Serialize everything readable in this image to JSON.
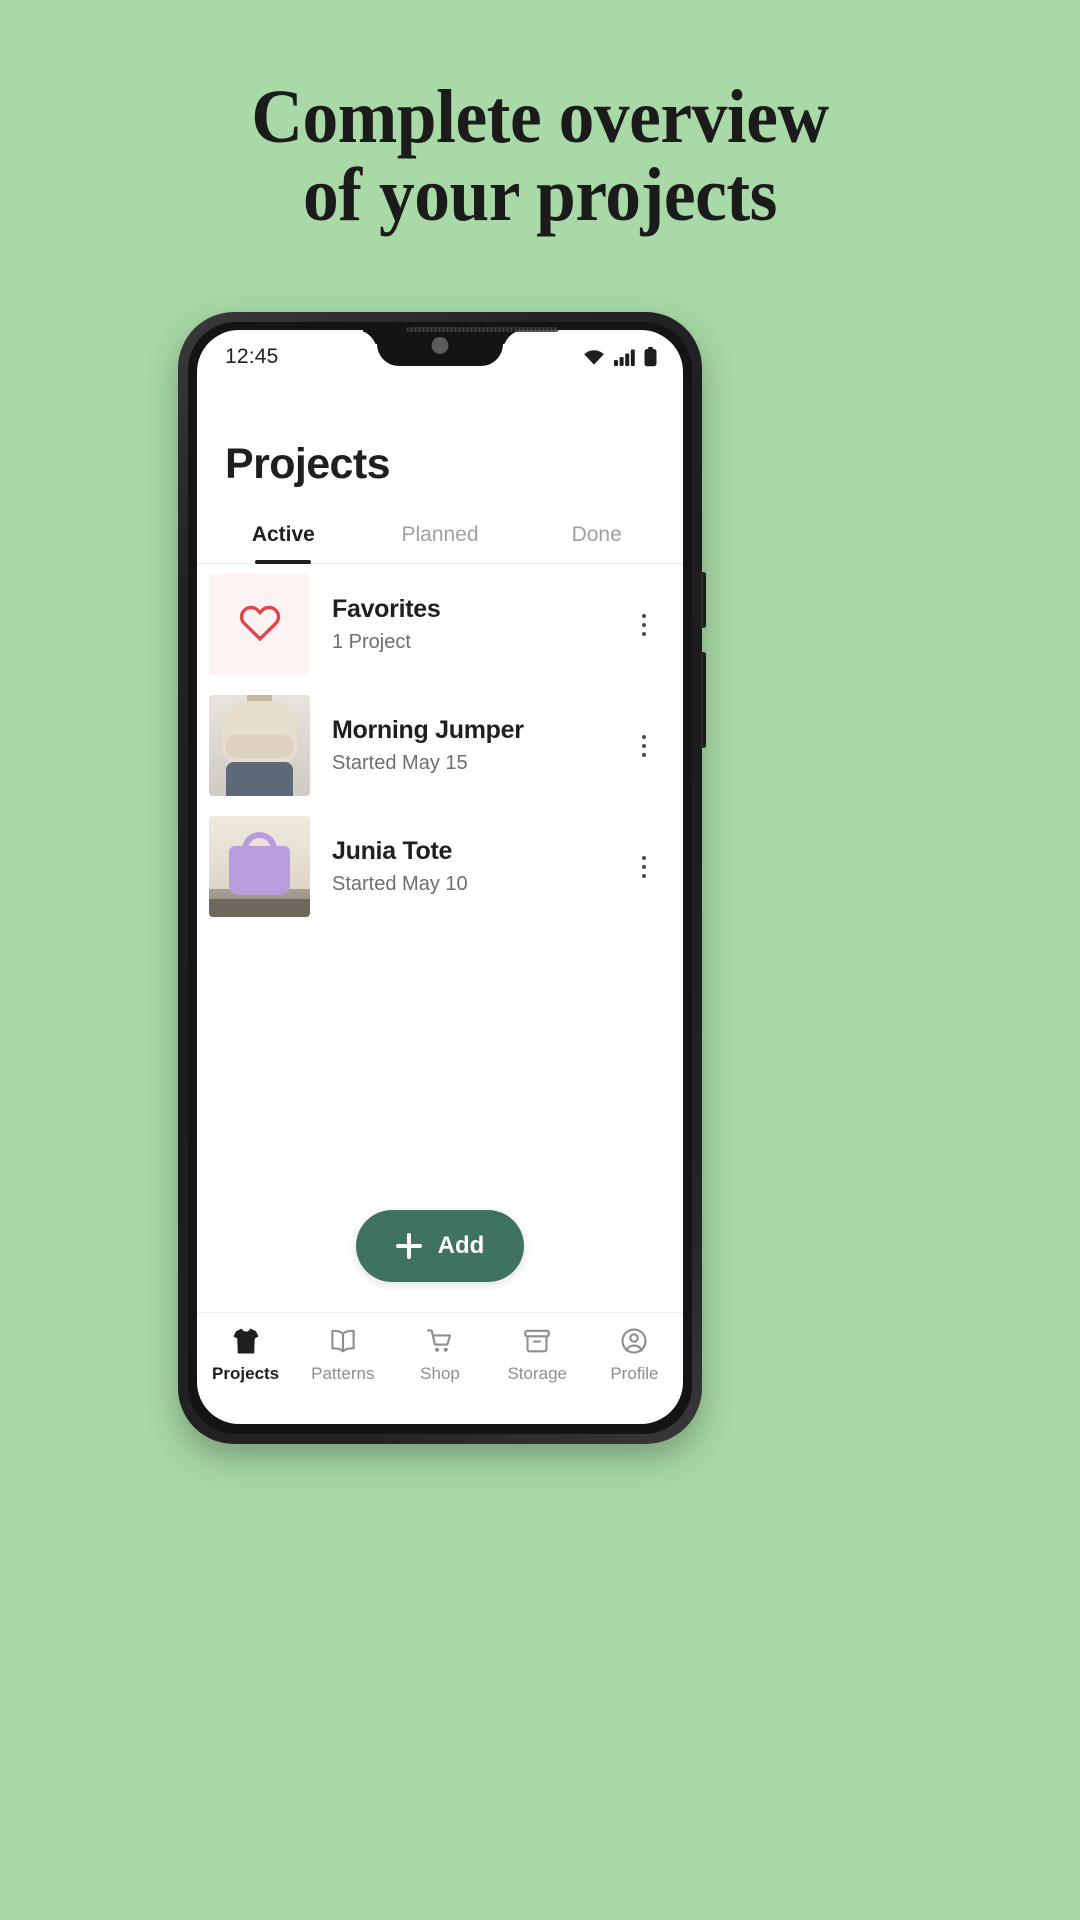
{
  "poster": {
    "background_color": "#a9d9a6",
    "headline_line1": "Complete overview",
    "headline_line2": "of your projects",
    "headline_color": "#1b1b1b"
  },
  "status_bar": {
    "time": "12:45",
    "icons": [
      "wifi-icon",
      "cellular-signal-icon",
      "battery-icon"
    ]
  },
  "app": {
    "page_title": "Projects",
    "accent_color": "#3f7360",
    "tabs": [
      {
        "label": "Active",
        "active": true
      },
      {
        "label": "Planned",
        "active": false
      },
      {
        "label": "Done",
        "active": false
      }
    ],
    "projects": [
      {
        "title": "Favorites",
        "subtitle": "1 Project",
        "thumb": "heart-icon",
        "thumb_color": "#e0474c",
        "menu": "kebab-menu-icon"
      },
      {
        "title": "Morning Jumper",
        "subtitle": "Started May 15",
        "thumb": "photo-cream-sweater",
        "menu": "kebab-menu-icon"
      },
      {
        "title": "Junia Tote",
        "subtitle": "Started May 10",
        "thumb": "photo-lilac-tote-bag",
        "menu": "kebab-menu-icon"
      }
    ],
    "add_button": {
      "label": "Add",
      "icon": "plus-icon"
    },
    "bottom_nav": [
      {
        "label": "Projects",
        "icon": "tshirt-icon",
        "active": true
      },
      {
        "label": "Patterns",
        "icon": "book-open-icon",
        "active": false
      },
      {
        "label": "Shop",
        "icon": "shopping-cart-icon",
        "active": false
      },
      {
        "label": "Storage",
        "icon": "archive-box-icon",
        "active": false
      },
      {
        "label": "Profile",
        "icon": "user-circle-icon",
        "active": false
      }
    ]
  }
}
